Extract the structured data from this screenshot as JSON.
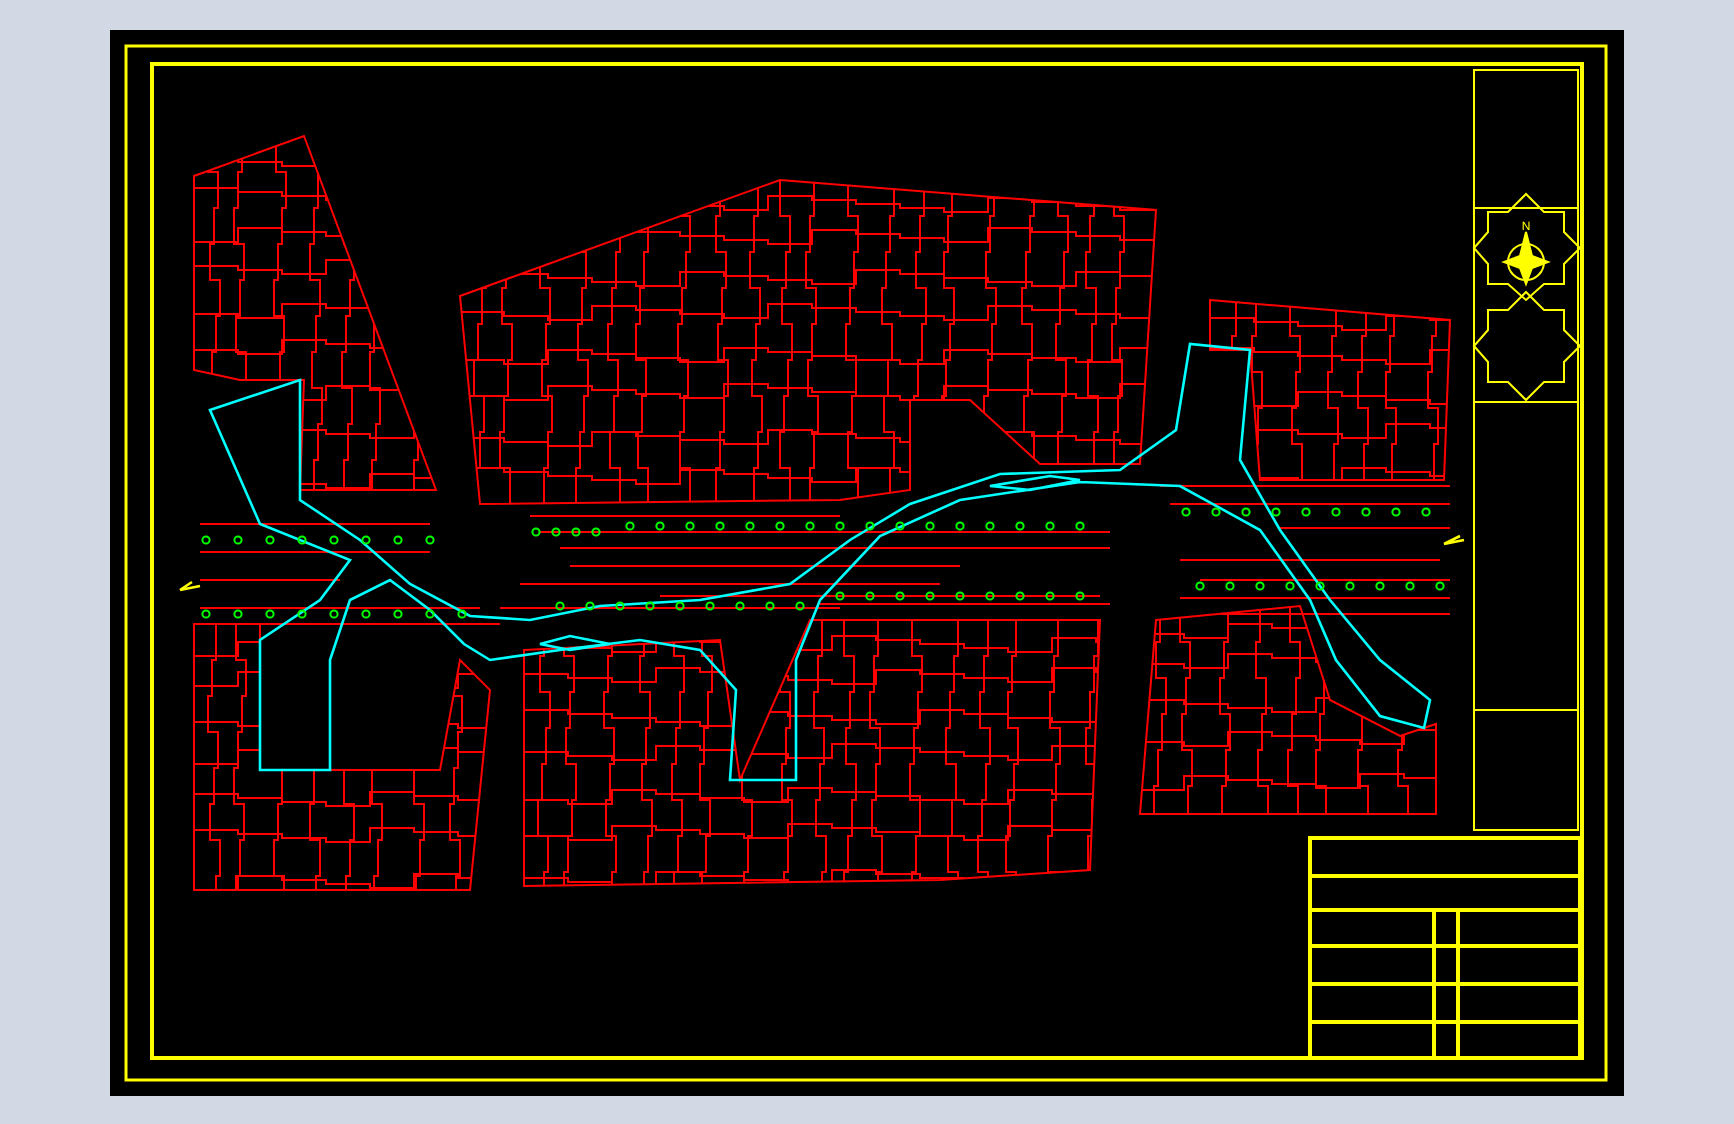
{
  "drawing": {
    "north_arrow": {
      "label": "N"
    }
  }
}
